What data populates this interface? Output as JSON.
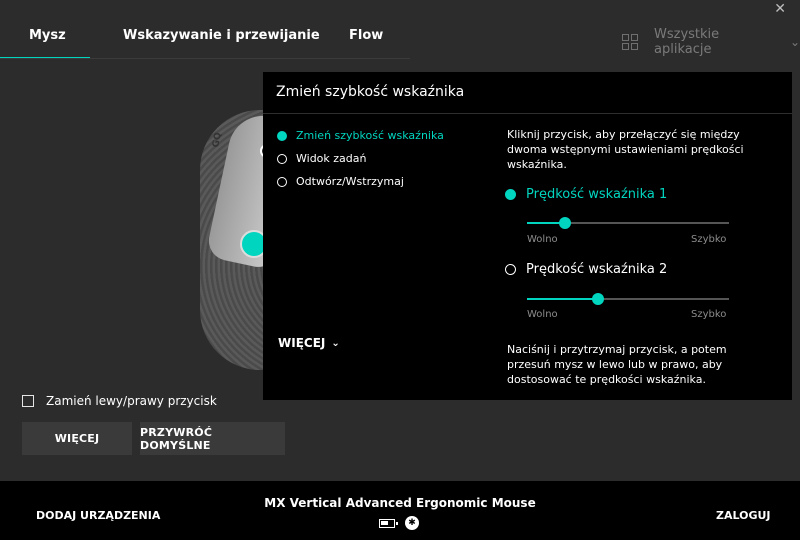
{
  "window": {
    "close_glyph": "✕"
  },
  "tabs": [
    {
      "label": "Mysz",
      "active": true
    },
    {
      "label": "Wskazywanie i przewijanie",
      "active": false
    },
    {
      "label": "Flow",
      "active": false
    }
  ],
  "apps_filter": {
    "label": "Wszystkie aplikacje",
    "icon": "grid-icon"
  },
  "mouse_image": {
    "logo_text": "GQ"
  },
  "left_controls": {
    "swap_label": "Zamień lewy/prawy przycisk",
    "swap_checked": false,
    "more_button": "WIĘCEJ",
    "restore_button": "PRZYWRÓĆ DOMYŚLNE"
  },
  "panel": {
    "title": "Zmień szybkość wskaźnika",
    "options": [
      {
        "label": "Zmień szybkość wskaźnika",
        "selected": true
      },
      {
        "label": "Widok zadań",
        "selected": false
      },
      {
        "label": "Odtwórz/Wstrzymaj",
        "selected": false
      }
    ],
    "more_label": "WIĘCEJ",
    "description_top": "Kliknij przycisk, aby przełączyć się między dwoma wstępnymi ustawieniami prędkości wskaźnika.",
    "speeds": [
      {
        "label": "Prędkość wskaźnika 1",
        "selected": true,
        "value_percent": 19,
        "min_label": "Wolno",
        "max_label": "Szybko"
      },
      {
        "label": "Prędkość wskaźnika 2",
        "selected": false,
        "value_percent": 35,
        "min_label": "Wolno",
        "max_label": "Szybko"
      }
    ],
    "description_bottom": "Naciśnij i przytrzymaj przycisk, a potem przesuń mysz w lewo lub w prawo, aby dostosować te prędkości wskaźnika."
  },
  "footer": {
    "add_devices": "DODAJ URZĄDZENIA",
    "device_name": "MX Vertical Advanced Ergonomic Mouse",
    "battery_level_percent": 60,
    "bluetooth_glyph": "✱",
    "login": "ZALOGUJ"
  },
  "colors": {
    "accent": "#00d5c0",
    "background": "#2c2c2c",
    "panel": "#000000"
  }
}
